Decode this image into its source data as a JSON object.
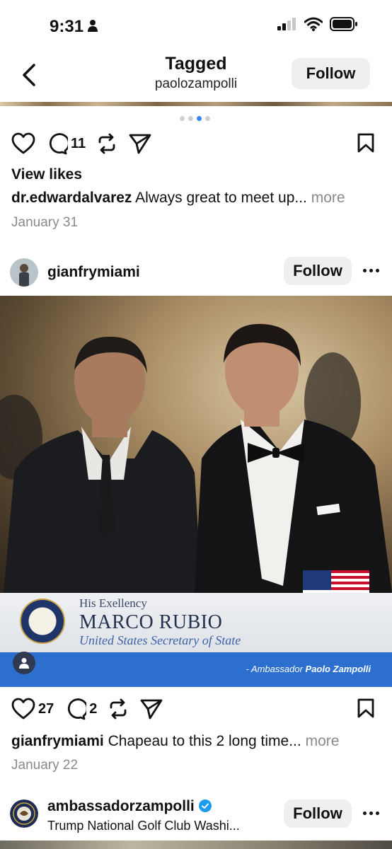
{
  "status": {
    "time": "9:31"
  },
  "header": {
    "title": "Tagged",
    "subtitle": "paolozampolli",
    "follow_label": "Follow"
  },
  "carousel": {
    "count": 4,
    "active": 3
  },
  "post1": {
    "comments": "11",
    "view_likes": "View likes",
    "caption_user": "dr.edwardalvarez",
    "caption_text": "Always great to meet up...",
    "more": "more",
    "date": "January 31"
  },
  "post2": {
    "username": "gianfrymiami",
    "follow_label": "Follow",
    "image": {
      "title_small": "His Exellency",
      "name": "MARCO RUBIO",
      "role": "United States Secretary of State",
      "credit_prefix": "- Ambassador ",
      "credit_name": "Paolo Zampolli"
    },
    "likes": "27",
    "comments": "2",
    "caption_user": "gianfrymiami",
    "caption_text": "Chapeau to this 2 long time...",
    "more": "more",
    "date": "January 22"
  },
  "post3": {
    "username": "ambassadorzampolli",
    "location": "Trump National Golf Club Washi...",
    "follow_label": "Follow",
    "verified_color": "#1d9bf0"
  },
  "colors": {
    "accent": "#3b82f6",
    "banner_blue": "#2d6fcf"
  }
}
